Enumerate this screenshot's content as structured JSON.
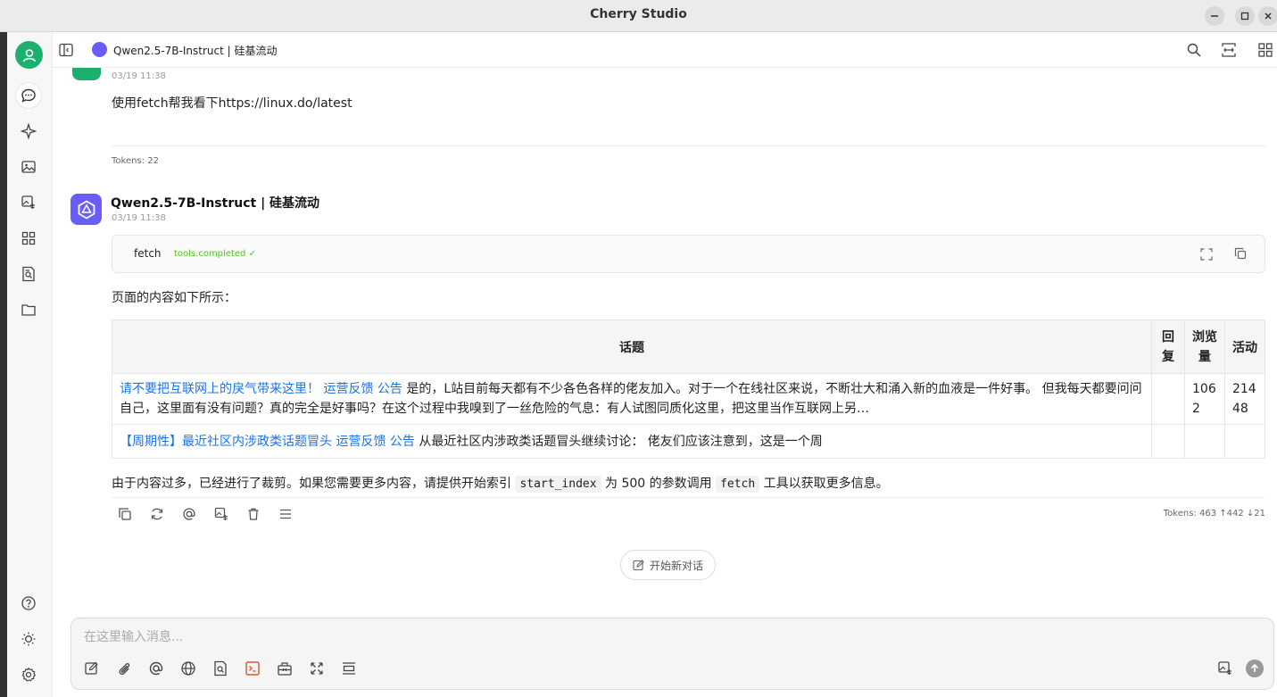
{
  "window": {
    "title": "Cherry Studio"
  },
  "topbar": {
    "model_title": "Qwen2.5-7B-Instruct | 硅基流动"
  },
  "user_message": {
    "time": "03/19 11:38",
    "text": "使用fetch帮我看下https://linux.do/latest",
    "tokens": "Tokens: 22"
  },
  "ai_message": {
    "name": "Qwen2.5-7B-Instruct | 硅基流动",
    "time": "03/19 11:38",
    "tool": {
      "name": "fetch",
      "status": "tools.completed"
    },
    "intro": "页面的内容如下所示：",
    "table": {
      "headers": [
        "话题",
        "回复",
        "浏览量",
        "活动"
      ],
      "rows": [
        {
          "link1": "请不要把互联网上的戾气带来这里！",
          "link2": "运营反馈",
          "link3": "公告",
          "text": "是的，L站目前每天都有不少各色各样的佬友加入。对于一个在线社区来说，不断壮大和涌入新的血液是一件好事。 但我每天都要问问自己，这里面有没有问题？真的完全是好事吗？在这个过程中我嗅到了一丝危险的气息：有人试图同质化这里，把这里当作互联网上另…",
          "reply": "",
          "views": "1062",
          "activity": "21448"
        },
        {
          "link1": "【周期性】最近社区内涉政类话题冒头",
          "link2": "运营反馈",
          "link3": "公告",
          "text": "从最近社区内涉政类话题冒头继续讨论： 佬友们应该注意到，这是一个周",
          "reply": "",
          "views": "",
          "activity": ""
        }
      ]
    },
    "outro_prefix": "由于内容过多，已经进行了裁剪。如果您需要更多内容，请提供开始索引",
    "outro_code1": "start_index",
    "outro_mid": "为 500 的参数调用",
    "outro_code2": "fetch",
    "outro_suffix": "工具以获取更多信息。",
    "tokens": "Tokens: 463 ↑442 ↓21"
  },
  "new_chat": {
    "label": "开始新对话"
  },
  "input": {
    "placeholder": "在这里输入消息..."
  },
  "colors": {
    "accent_green": "#1bb06e",
    "model_purple": "#6a5cf6",
    "link_blue": "#1a73e8",
    "status_green": "#52c41a"
  }
}
